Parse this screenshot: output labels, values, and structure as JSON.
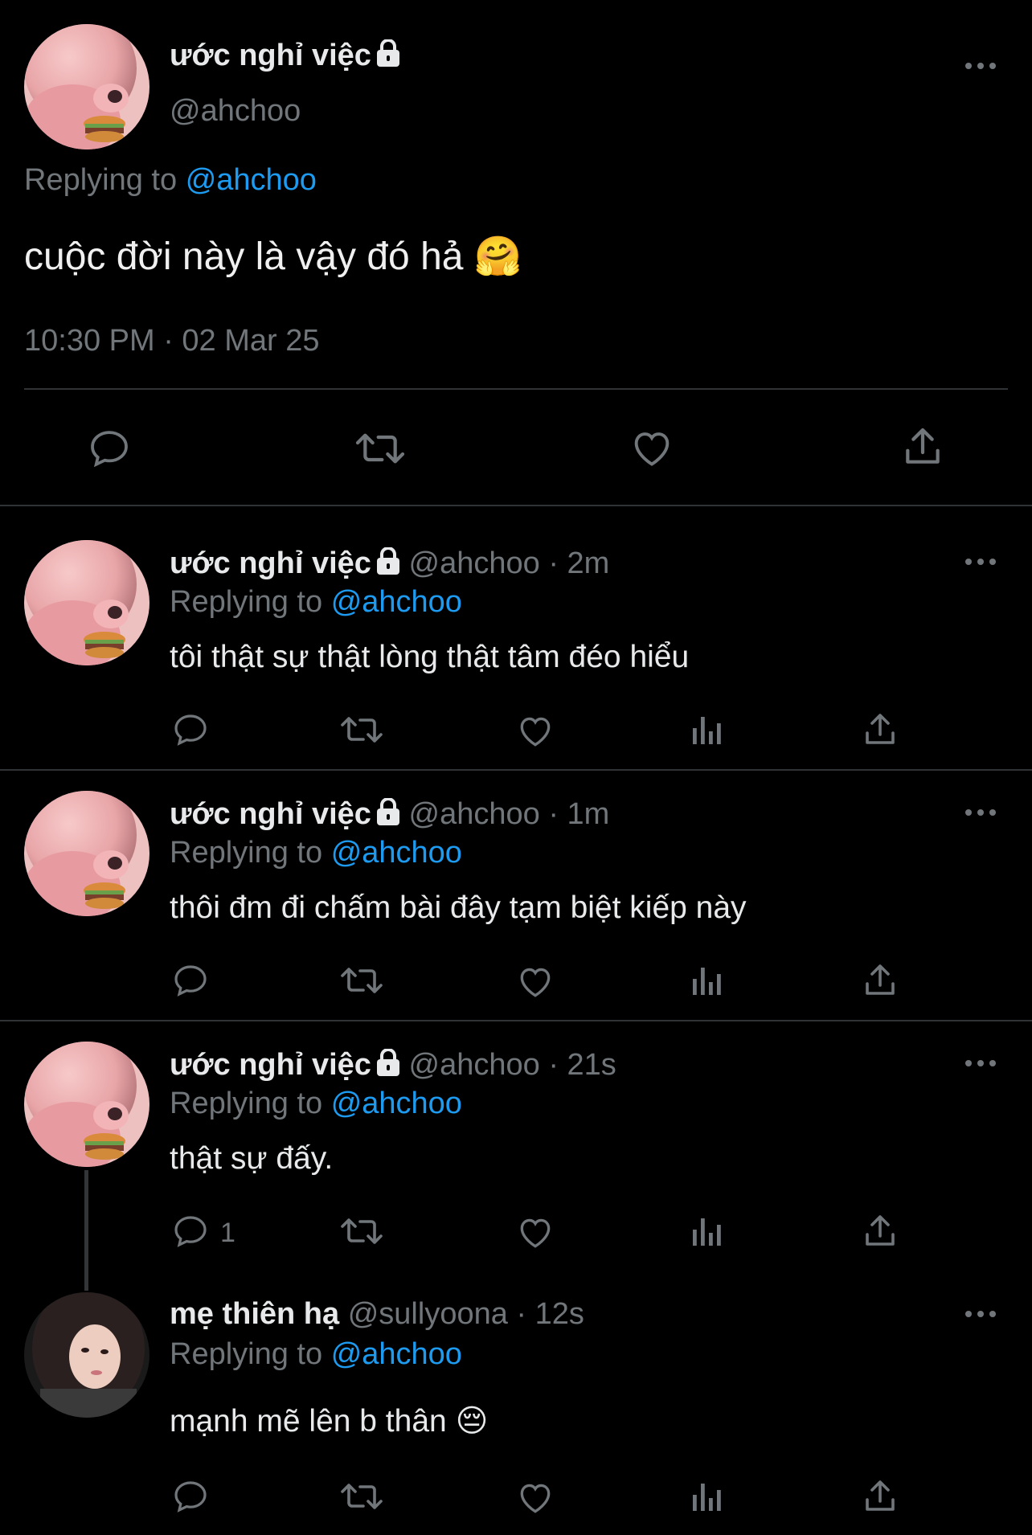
{
  "main_tweet": {
    "display_name": "ước nghỉ việc",
    "handle": "@ahchoo",
    "replying_label": "Replying to",
    "replying_to": "@ahchoo",
    "text": "cuộc đời này là vậy đó hả",
    "emoji": "🤗",
    "timestamp": "10:30 PM · 02 Mar 25"
  },
  "replies": [
    {
      "display_name": "ước nghỉ việc",
      "handle": "@ahchoo",
      "time": "· 2m",
      "replying_label": "Replying to",
      "replying_to": "@ahchoo",
      "text": "tôi thật sự thật lòng thật tâm đéo hiểu"
    },
    {
      "display_name": "ước nghỉ việc",
      "handle": "@ahchoo",
      "time": "· 1m",
      "replying_label": "Replying to",
      "replying_to": "@ahchoo",
      "text": "thôi đm đi chấm bài đây tạm biệt kiếp này"
    },
    {
      "display_name": "ước nghỉ việc",
      "handle": "@ahchoo",
      "time": "· 21s",
      "replying_label": "Replying to",
      "replying_to": "@ahchoo",
      "text": "thật sự đấy.",
      "reply_count": "1"
    },
    {
      "display_name": "mẹ thiên hạ",
      "handle": "@sullyoona",
      "time": "· 12s",
      "replying_label": "Replying to",
      "replying_to": "@ahchoo",
      "text": "mạnh mẽ lên b thân",
      "emoji": "😔"
    }
  ],
  "colors": {
    "background": "#000000",
    "text": "#e7e9ea",
    "muted": "#71767b",
    "link": "#1d9bf0",
    "divider": "#2f3336"
  },
  "icons": [
    "lock-icon",
    "more-icon",
    "reply-icon",
    "retweet-icon",
    "like-icon",
    "views-icon",
    "share-icon"
  ]
}
